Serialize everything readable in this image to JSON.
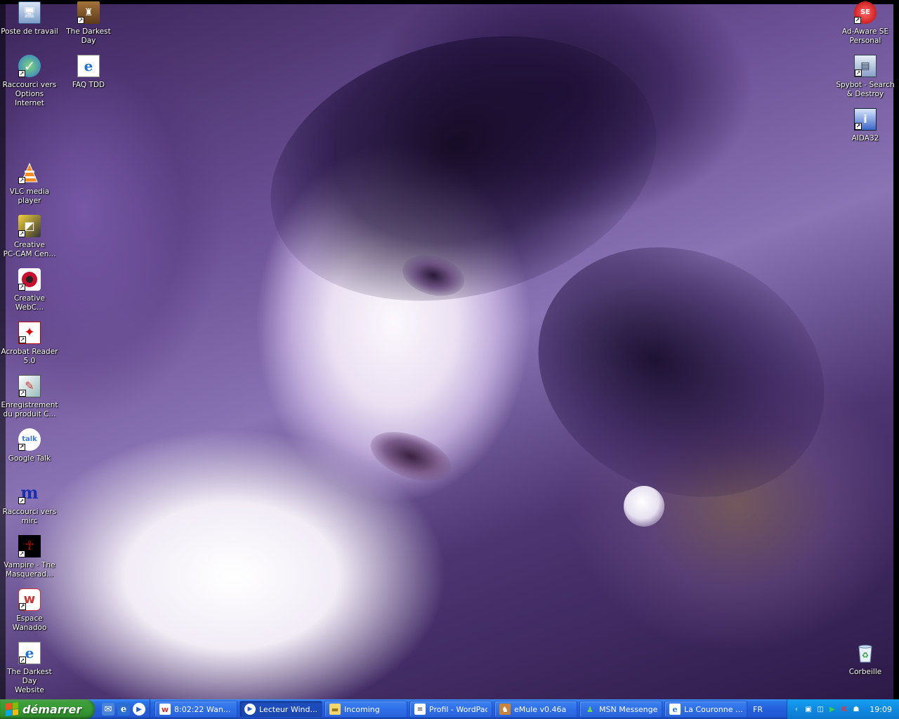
{
  "desktop": {
    "icons_left_col1": [
      {
        "label": "Poste de travail",
        "icon": "my-computer-icon"
      },
      {
        "label": "Raccourci vers\nOptions Internet",
        "icon": "internet-options-icon"
      },
      {
        "label": "VLC media\nplayer",
        "icon": "vlc-icon"
      },
      {
        "label": "Creative\nPC-CAM Cen...",
        "icon": "pc-cam-center-icon"
      },
      {
        "label": "Creative\nWebC...",
        "icon": "webcam-icon"
      },
      {
        "label": "Acrobat Reader\n5.0",
        "icon": "acrobat-reader-icon"
      },
      {
        "label": "Enregistrement\ndu produit C...",
        "icon": "product-registration-icon"
      },
      {
        "label": "Google Talk",
        "icon": "google-talk-icon"
      },
      {
        "label": "Raccourci vers\nmirc",
        "icon": "mirc-icon"
      },
      {
        "label": "Vampire - The\nMasquerad...",
        "icon": "vampire-game-icon"
      },
      {
        "label": "Espace\nWanadoo",
        "icon": "wanadoo-icon"
      },
      {
        "label": "The Darkest Day\nWebsite",
        "icon": "ie-website-icon"
      }
    ],
    "icons_left_col2": [
      {
        "label": "The Darkest Day",
        "icon": "darkest-day-folder-icon"
      },
      {
        "label": "FAQ TDD",
        "icon": "ie-faq-icon"
      }
    ],
    "icons_right": [
      {
        "label": "Ad-Aware SE\nPersonal",
        "icon": "ad-aware-icon"
      },
      {
        "label": "Spybot - Search\n& Destroy",
        "icon": "spybot-icon"
      },
      {
        "label": "AIDA32",
        "icon": "aida32-icon"
      },
      {
        "label": "Corbeille",
        "icon": "recycle-bin-icon"
      }
    ]
  },
  "taskbar": {
    "start_label": "démarrer",
    "quick_launch": [
      "outlook-express-icon",
      "internet-explorer-icon",
      "media-player-icon"
    ],
    "tasks": [
      {
        "label": "8:02:22 Wan...",
        "icon": "wanadoo-icon",
        "active": false
      },
      {
        "label": "Lecteur Wind...",
        "icon": "media-player-icon",
        "active": true
      },
      {
        "label": "Incoming",
        "icon": "folder-icon",
        "active": false
      },
      {
        "label": "Profil - WordPad",
        "icon": "wordpad-icon",
        "active": false
      },
      {
        "label": "eMule v0.46a",
        "icon": "emule-icon",
        "active": false
      },
      {
        "label": "MSN Messenger",
        "icon": "msn-icon",
        "active": false
      },
      {
        "label": "La Couronne ...",
        "icon": "ie-icon",
        "active": false
      }
    ],
    "language": "FR",
    "tray_icons": [
      "expand-icon",
      "network-icon",
      "network2-icon",
      "play-icon",
      "antivirus-icon",
      "spy-icon"
    ],
    "clock": "19:09"
  },
  "colors": {
    "taskbar_blue": "#245edb",
    "start_green": "#379b34",
    "tray_blue": "#0f8ae0"
  }
}
